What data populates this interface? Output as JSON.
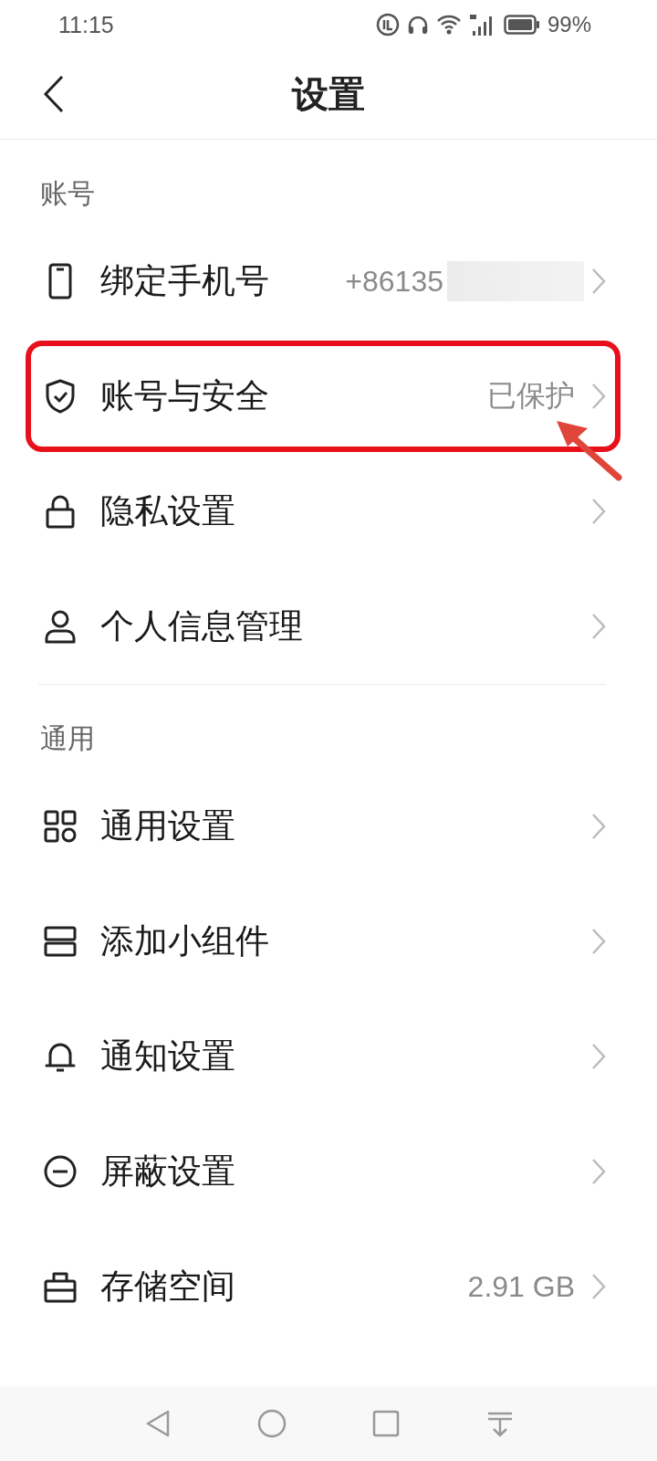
{
  "status_bar": {
    "time": "11:15",
    "battery": "99%"
  },
  "header": {
    "title": "设置"
  },
  "sections": [
    {
      "title": "账号",
      "rows": [
        {
          "kind": "phone",
          "label": "绑定手机号",
          "value": "+86135",
          "redacted": true,
          "highlighted": false
        },
        {
          "kind": "shield",
          "label": "账号与安全",
          "value": "已保护",
          "redacted": false,
          "highlighted": true
        },
        {
          "kind": "lock",
          "label": "隐私设置",
          "redacted": false,
          "highlighted": false
        },
        {
          "kind": "person",
          "label": "个人信息管理",
          "redacted": false,
          "highlighted": false
        }
      ]
    },
    {
      "title": "通用",
      "rows": [
        {
          "kind": "grid",
          "label": "通用设置",
          "redacted": false,
          "highlighted": false
        },
        {
          "kind": "widget",
          "label": "添加小组件",
          "redacted": false,
          "highlighted": false
        },
        {
          "kind": "bell",
          "label": "通知设置",
          "redacted": false,
          "highlighted": false
        },
        {
          "kind": "block",
          "label": "屏蔽设置",
          "redacted": false,
          "highlighted": false
        },
        {
          "kind": "storage",
          "label": "存储空间",
          "value": "2.91 GB",
          "redacted": false,
          "highlighted": false
        }
      ]
    }
  ]
}
